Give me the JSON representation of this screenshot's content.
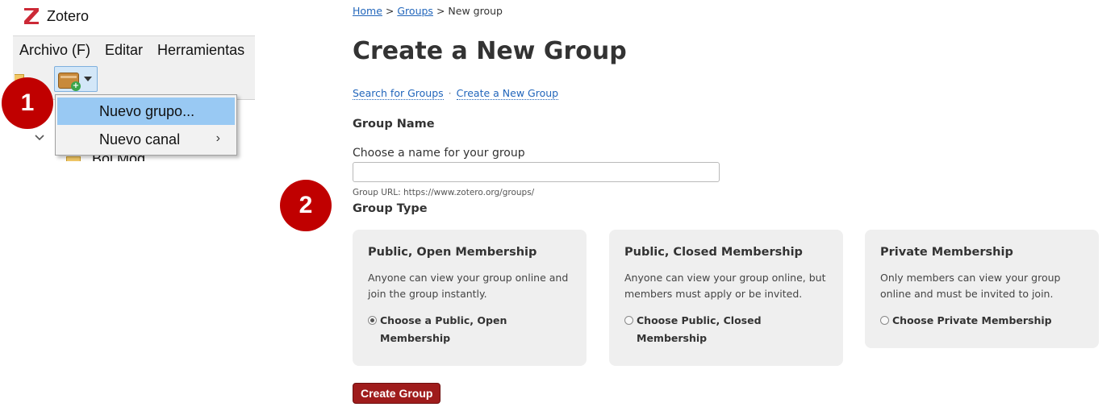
{
  "desktop": {
    "app_title": "Zotero",
    "menu": [
      "Archivo (F)",
      "Editar",
      "Herramientas"
    ],
    "new_group_dropdown": {
      "items": [
        {
          "label": "Nuevo grupo...",
          "highlighted": true
        },
        {
          "label": "Nuevo canal",
          "submenu": true
        }
      ]
    },
    "tree_partial_text": "Bol Mod"
  },
  "steps": {
    "one": "1",
    "two": "2"
  },
  "web": {
    "breadcrumb": {
      "home": "Home",
      "sep1": ">",
      "groups": "Groups",
      "sep2": ">",
      "current": "New group"
    },
    "page_title": "Create a New Group",
    "subnav": {
      "search": "Search for Groups",
      "sep": "·",
      "create": "Create a New Group"
    },
    "group_name": {
      "heading": "Group Name",
      "label": "Choose a name for your group",
      "value": "",
      "url_hint": "Group URL: https://www.zotero.org/groups/"
    },
    "group_type": {
      "heading": "Group Type",
      "options": [
        {
          "title": "Public, Open Membership",
          "description": "Anyone can view your group online and join the group instantly.",
          "choice": "Choose a Public, Open Membership",
          "selected": true
        },
        {
          "title": "Public, Closed Membership",
          "description": "Anyone can view your group online, but members must apply or be invited.",
          "choice": "Choose Public, Closed Membership",
          "selected": false
        },
        {
          "title": "Private Membership",
          "description": "Only members can view your group online and must be invited to join.",
          "choice": "Choose Private Membership",
          "selected": false
        }
      ]
    },
    "submit_label": "Create Group"
  },
  "colors": {
    "badge": "#c00000",
    "link": "#2266bb",
    "submit_button": "#9f1c1c",
    "menu_highlight": "#99c9f3",
    "card_background": "#efefef"
  },
  "icons": [
    "zotero-logo-icon",
    "new-group-icon",
    "plus-icon",
    "dropdown-caret-icon",
    "submenu-arrow-icon",
    "chevron-down-icon",
    "folder-icon"
  ]
}
